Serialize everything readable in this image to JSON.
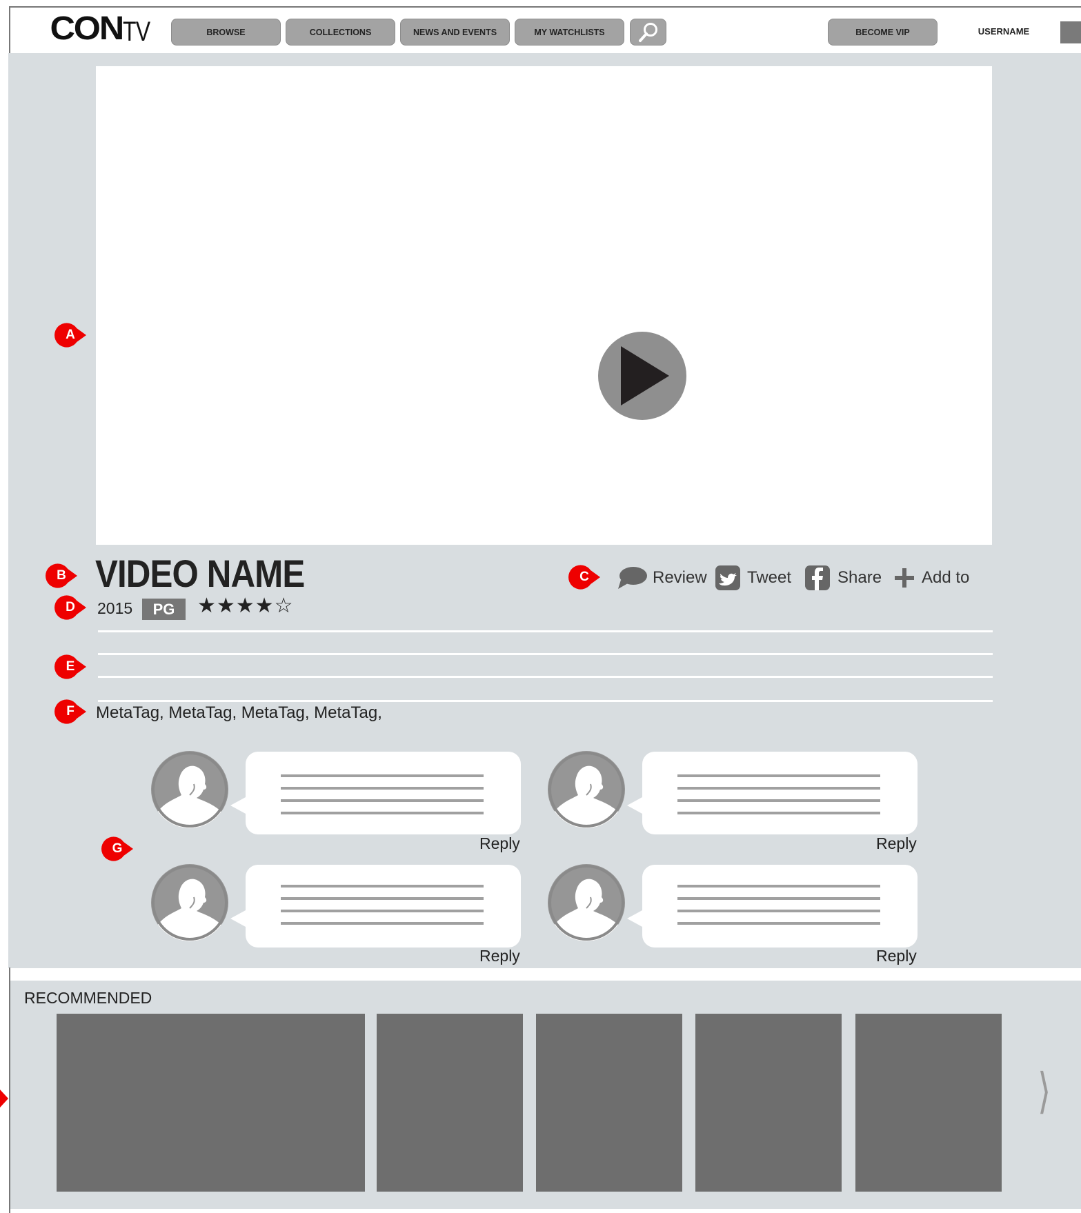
{
  "header": {
    "logo_main": "CON",
    "logo_suffix": "TV",
    "nav": [
      "BROWSE",
      "COLLECTIONS",
      "NEWS AND EVENTS",
      "MY WATCHLISTS"
    ],
    "search_icon": "search-icon",
    "vip_label": "BECOME VIP",
    "username": "USERNAME"
  },
  "annotations": [
    "A",
    "B",
    "C",
    "D",
    "E",
    "F",
    "G"
  ],
  "video": {
    "title": "VIDEO NAME",
    "play_icon": "play-icon",
    "year": "2015",
    "rating_badge": "PG",
    "stars_filled": 4,
    "stars_total": 5,
    "stars_text": "★★★★☆"
  },
  "actions": [
    {
      "icon": "speech-bubble-icon",
      "label": "Review"
    },
    {
      "icon": "twitter-icon",
      "label": "Tweet"
    },
    {
      "icon": "facebook-icon",
      "label": "Share"
    },
    {
      "icon": "plus-icon",
      "label": "Add to"
    }
  ],
  "metatags": "MetaTag, MetaTag, MetaTag, MetaTag,",
  "comments": [
    {
      "reply": "Reply"
    },
    {
      "reply": "Reply"
    },
    {
      "reply": "Reply"
    },
    {
      "reply": "Reply"
    }
  ],
  "recommended": {
    "label": "RECOMMENDED",
    "next_icon": "chevron-right-icon",
    "next_glyph": "⟩"
  },
  "colors": {
    "page_bg": "#d8dde0",
    "nav_button": "#a3a3a3",
    "marker_red": "#ee0000",
    "tile": "#6e6e6e"
  }
}
